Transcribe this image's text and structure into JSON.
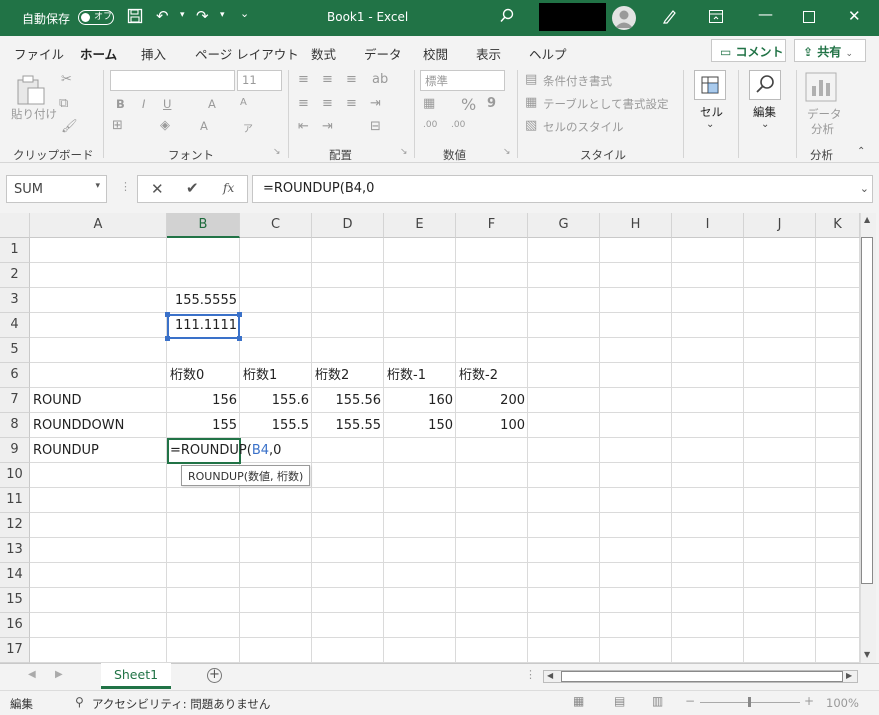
{
  "titlebar": {
    "autosave_label": "自動保存",
    "autosave_state": "オフ",
    "title": "Book1  -  Excel",
    "accent": "#217346"
  },
  "tabs": [
    "ファイル",
    "ホーム",
    "挿入",
    "ページ レイアウト",
    "数式",
    "データ",
    "校閲",
    "表示",
    "ヘルプ"
  ],
  "ribbon_actions": {
    "comment": "コメント",
    "share": "共有"
  },
  "ribbon": {
    "clipboard": {
      "paste": "貼り付け",
      "label": "クリップボード"
    },
    "font": {
      "font_size": "11",
      "label": "フォント"
    },
    "alignment": {
      "label": "配置"
    },
    "number": {
      "format": "標準",
      "label": "数値"
    },
    "styles": {
      "conditional": "条件付き書式",
      "table": "テーブルとして書式設定",
      "cell_styles": "セルのスタイル",
      "label": "スタイル"
    },
    "cells": {
      "label": "セル"
    },
    "editing": {
      "label": "編集"
    },
    "analysis": {
      "button_line1": "データ",
      "button_line2": "分析",
      "label": "分析"
    }
  },
  "formula_bar": {
    "name_box": "SUM",
    "fx": "fx",
    "formula": "=ROUNDUP(B4,0"
  },
  "grid": {
    "columns": [
      "A",
      "B",
      "C",
      "D",
      "E",
      "F",
      "G",
      "H",
      "I",
      "J",
      "K"
    ],
    "rows": [
      "1",
      "2",
      "3",
      "4",
      "5",
      "6",
      "7",
      "8",
      "9",
      "10",
      "11",
      "12",
      "13",
      "14",
      "15",
      "16",
      "17"
    ],
    "cells": {
      "B3": "155.5555",
      "B4": "111.1111",
      "B6": "桁数0",
      "C6": "桁数1",
      "D6": "桁数2",
      "E6": "桁数-1",
      "F6": "桁数-2",
      "A7": "ROUND",
      "B7": "156",
      "C7": "155.6",
      "D7": "155.56",
      "E7": "160",
      "F7": "200",
      "A8": "ROUNDDOWN",
      "B8": "155",
      "C8": "155.5",
      "D8": "155.55",
      "E8": "150",
      "F8": "100",
      "A9": "ROUNDUP"
    },
    "edit_cell": {
      "prefix": "=ROUNDUP(",
      "ref": "B4",
      "suffix": ",0",
      "ref_color": "#3a71c9"
    },
    "tooltip": "ROUNDUP(数値, 桁数)"
  },
  "sheets": {
    "active": "Sheet1"
  },
  "status": {
    "mode": "編集",
    "accessibility": "アクセシビリティ: 問題ありません",
    "zoom": "100%"
  }
}
